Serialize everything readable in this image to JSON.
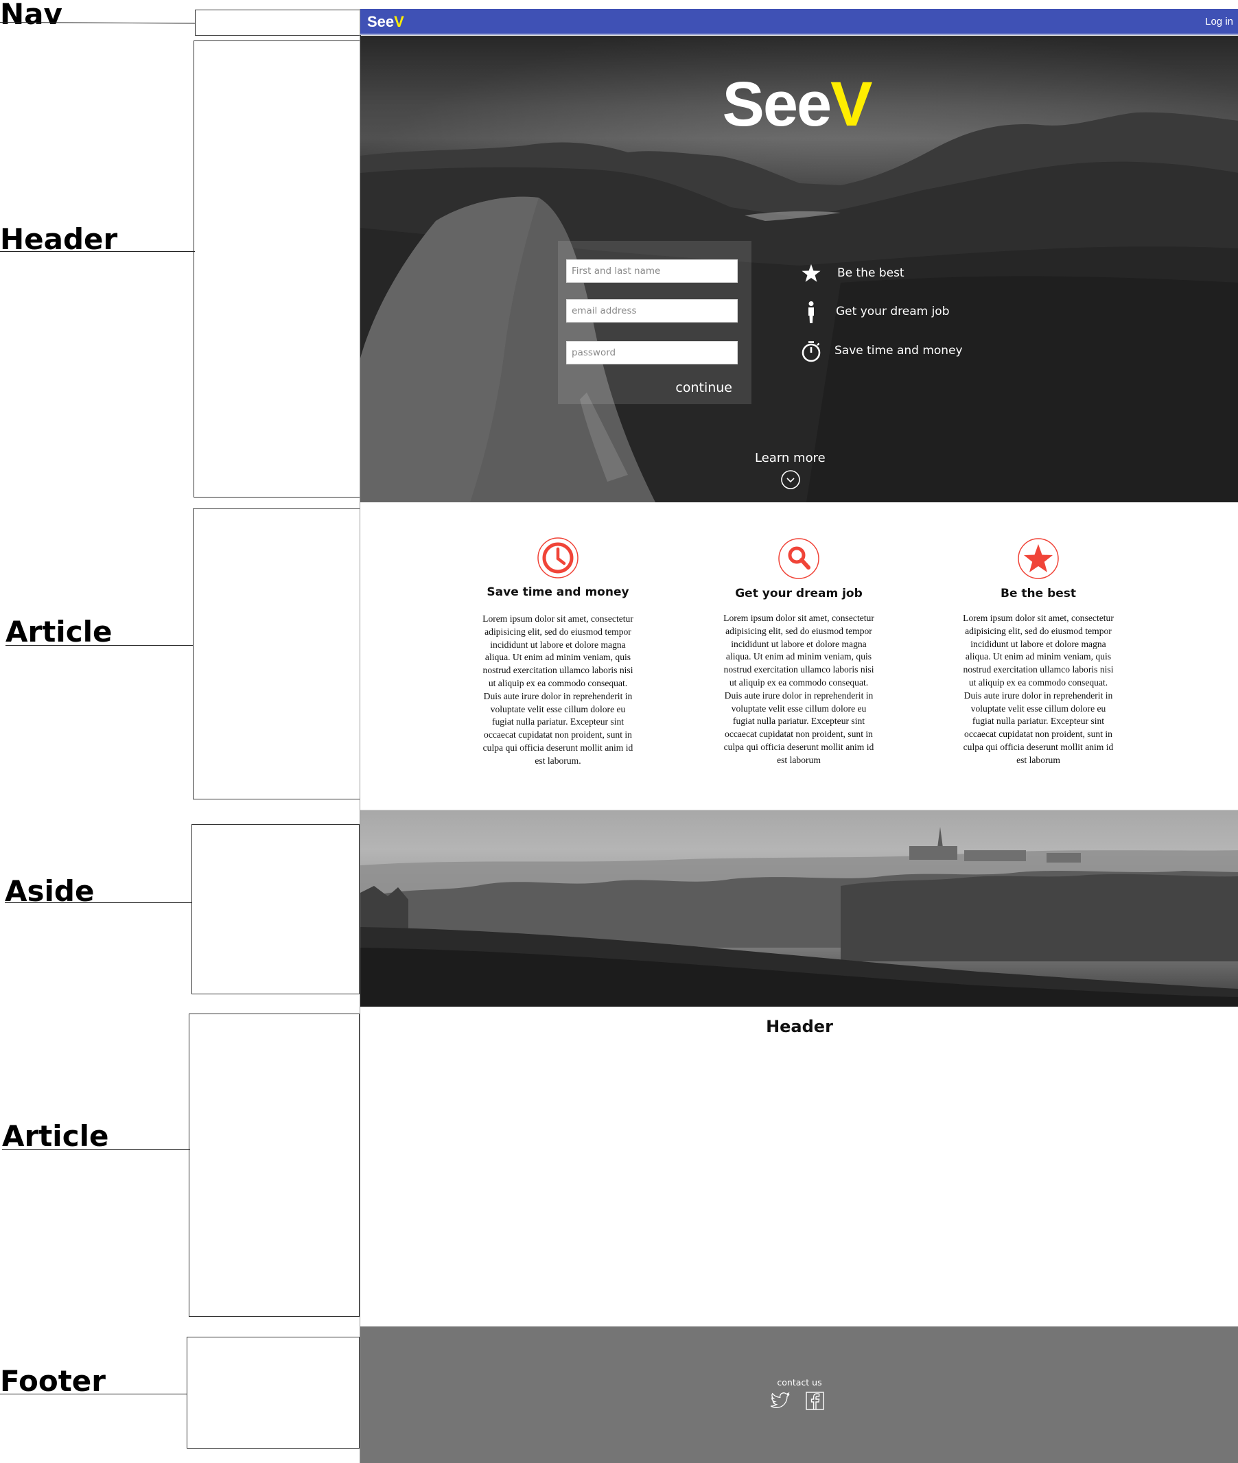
{
  "annotations": [
    {
      "label": "Nav"
    },
    {
      "label": "Header"
    },
    {
      "label": "Article"
    },
    {
      "label": "Aside"
    },
    {
      "label": "Article"
    },
    {
      "label": "Footer"
    }
  ],
  "nav": {
    "logo_prefix": "See",
    "logo_suffix": "V",
    "login_label": "Log in",
    "bar_color": "#3f51b5",
    "accent_color": "#ffee00"
  },
  "hero": {
    "logo_prefix": "See",
    "logo_suffix": "V",
    "form": {
      "name_placeholder": "First and last name",
      "email_placeholder": "email address",
      "password_placeholder": "password",
      "submit_label": "continue"
    },
    "benefits": [
      {
        "icon": "star-icon",
        "label": "Be the best"
      },
      {
        "icon": "person-icon",
        "label": "Get your dream job"
      },
      {
        "icon": "stopwatch-icon",
        "label": "Save time and money"
      }
    ],
    "learn_more_label": "Learn more"
  },
  "features": {
    "icon_color": "#f04438",
    "items": [
      {
        "icon": "clock-icon",
        "title": "Save time and money",
        "text": "Lorem ipsum dolor sit amet, consectetur adipisicing elit, sed do eiusmod tempor incididunt ut labore et dolore magna aliqua. Ut enim ad minim veniam, quis nostrud exercitation ullamco laboris nisi ut aliquip ex ea commodo consequat. Duis aute irure dolor in reprehenderit in voluptate velit esse cillum dolore eu fugiat nulla pariatur. Excepteur sint occaecat cupidatat non proident, sunt in culpa qui officia deserunt mollit anim id est laborum."
      },
      {
        "icon": "search-icon",
        "title": "Get your dream job",
        "text": "Lorem ipsum dolor sit amet, consectetur adipisicing elit, sed do eiusmod tempor incididunt ut labore et dolore magna aliqua. Ut enim ad minim veniam, quis nostrud exercitation ullamco laboris nisi ut aliquip ex ea commodo consequat. Duis aute irure dolor in reprehenderit in voluptate velit esse cillum dolore eu fugiat nulla pariatur. Excepteur sint occaecat cupidatat non proident, sunt in culpa qui officia deserunt mollit anim id est laborum"
      },
      {
        "icon": "star-icon",
        "title": "Be the best",
        "text": "Lorem ipsum dolor sit amet, consectetur adipisicing elit, sed do eiusmod tempor incididunt ut labore et dolore magna aliqua. Ut enim ad minim veniam, quis nostrud exercitation ullamco laboris nisi ut aliquip ex ea commodo consequat. Duis aute irure dolor in reprehenderit in voluptate velit esse cillum dolore eu fugiat nulla pariatur. Excepteur sint occaecat cupidatat non proident, sunt in culpa qui officia deserunt mollit anim id est laborum"
      }
    ]
  },
  "article2": {
    "heading": "Header"
  },
  "footer": {
    "contact_label": "contact us",
    "social": [
      {
        "icon": "twitter-icon"
      },
      {
        "icon": "facebook-icon"
      }
    ],
    "background": "#757575"
  }
}
